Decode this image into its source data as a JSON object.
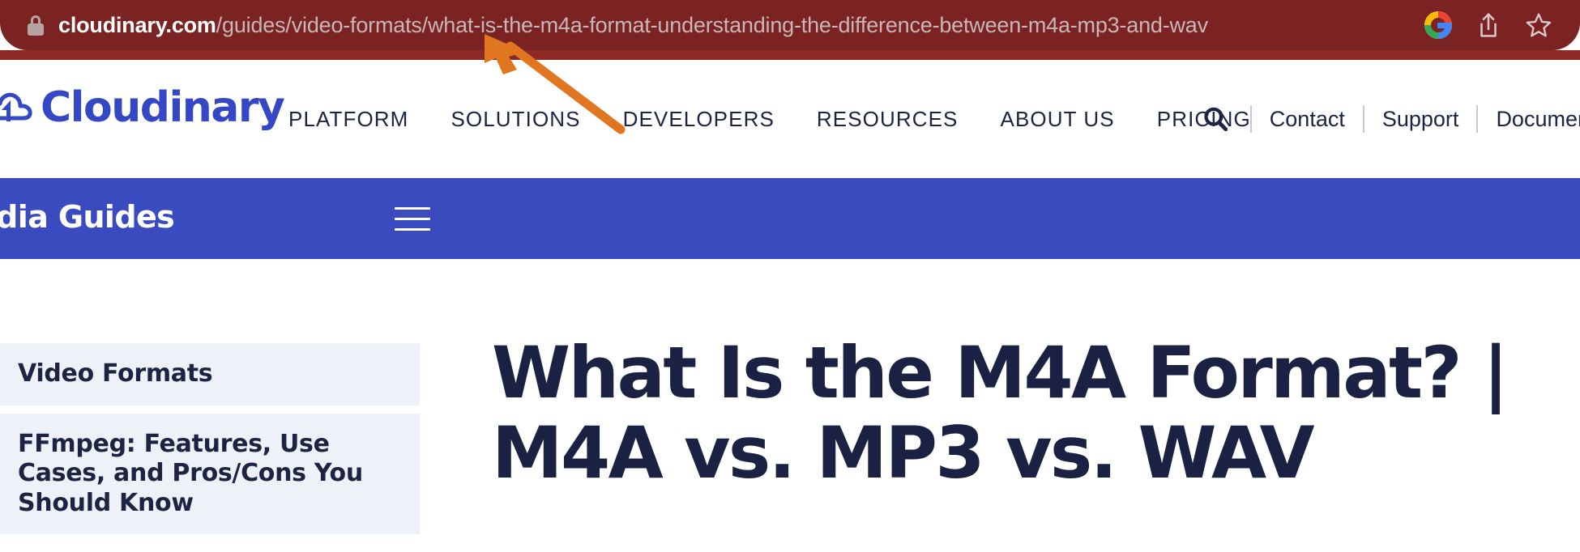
{
  "browser": {
    "url_host": "cloudinary.com",
    "url_path": "/guides/video-formats/what-is-the-m4a-format-understanding-the-difference-between-m4a-mp3-and-wav",
    "lock_icon": "lock-icon",
    "google_icon": "google-g-icon",
    "share_icon": "share-icon",
    "bookmark_icon": "star-bookmark-icon",
    "bar_color": "#7b2222"
  },
  "header": {
    "logo_text": "Cloudinary",
    "logo_color": "#3448c5",
    "nav_items": [
      {
        "label": "PLATFORM"
      },
      {
        "label": "SOLUTIONS"
      },
      {
        "label": "DEVELOPERS"
      },
      {
        "label": "RESOURCES"
      },
      {
        "label": "ABOUT US"
      },
      {
        "label": "PRICING"
      }
    ],
    "search_icon": "search-icon",
    "util_links": [
      {
        "label": "Contact"
      },
      {
        "label": "Support"
      },
      {
        "label": "Documen"
      }
    ]
  },
  "guides_band": {
    "title": "edia Guides",
    "background": "#3a4bbf",
    "menu_icon": "hamburger-menu-icon"
  },
  "sidebar": {
    "items": [
      {
        "label": "Video Formats"
      },
      {
        "label": "FFmpeg: Features, Use Cases, and Pros/Cons You Should Know"
      }
    ],
    "card_background": "#eef1f7"
  },
  "main": {
    "heading": "What Is the M4A Format? | M4A vs. MP3 vs. WAV",
    "heading_color": "#1a2142"
  },
  "annotation": {
    "type": "arrow",
    "color": "#e0761f",
    "points_to": "url-path-segment"
  }
}
